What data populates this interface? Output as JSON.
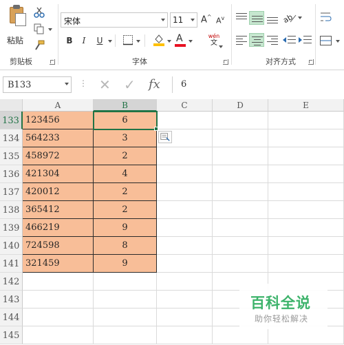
{
  "ribbon": {
    "clipboard": {
      "paste_label": "粘贴",
      "group_label": "剪贴板"
    },
    "font": {
      "group_label": "字体",
      "font_name": "宋体",
      "font_size": "11",
      "bold_label": "B",
      "italic_label": "I",
      "underline_label": "U",
      "grow_label": "A",
      "shrink_label": "A",
      "phonetic_label": "wén",
      "phonetic_sub": "文",
      "fill_color": "#ffc000",
      "font_color": "#e81123"
    },
    "alignment": {
      "group_label": "对齐方式"
    }
  },
  "formula_bar": {
    "name_box": "B133",
    "cancel_icon": "✕",
    "enter_icon": "✓",
    "fx_label": "fx",
    "content": "6"
  },
  "grid": {
    "columns": [
      "A",
      "B",
      "C",
      "D",
      "E"
    ],
    "selected_column": "B",
    "rows": [
      {
        "num": "133",
        "a": "123456",
        "b": "6"
      },
      {
        "num": "134",
        "a": "564233",
        "b": "3"
      },
      {
        "num": "135",
        "a": "458972",
        "b": "2"
      },
      {
        "num": "136",
        "a": "421304",
        "b": "4"
      },
      {
        "num": "137",
        "a": "420012",
        "b": "2"
      },
      {
        "num": "138",
        "a": "365412",
        "b": "2"
      },
      {
        "num": "139",
        "a": "466219",
        "b": "9"
      },
      {
        "num": "140",
        "a": "724598",
        "b": "8"
      },
      {
        "num": "141",
        "a": "321459",
        "b": "9"
      },
      {
        "num": "142",
        "a": "",
        "b": ""
      },
      {
        "num": "143",
        "a": "",
        "b": ""
      },
      {
        "num": "144",
        "a": "",
        "b": ""
      },
      {
        "num": "145",
        "a": "",
        "b": ""
      }
    ],
    "filled_color": "#f8be98",
    "accent_color": "#217346"
  },
  "watermark": {
    "title": "百科全说",
    "subtitle": "助你轻松解决"
  }
}
